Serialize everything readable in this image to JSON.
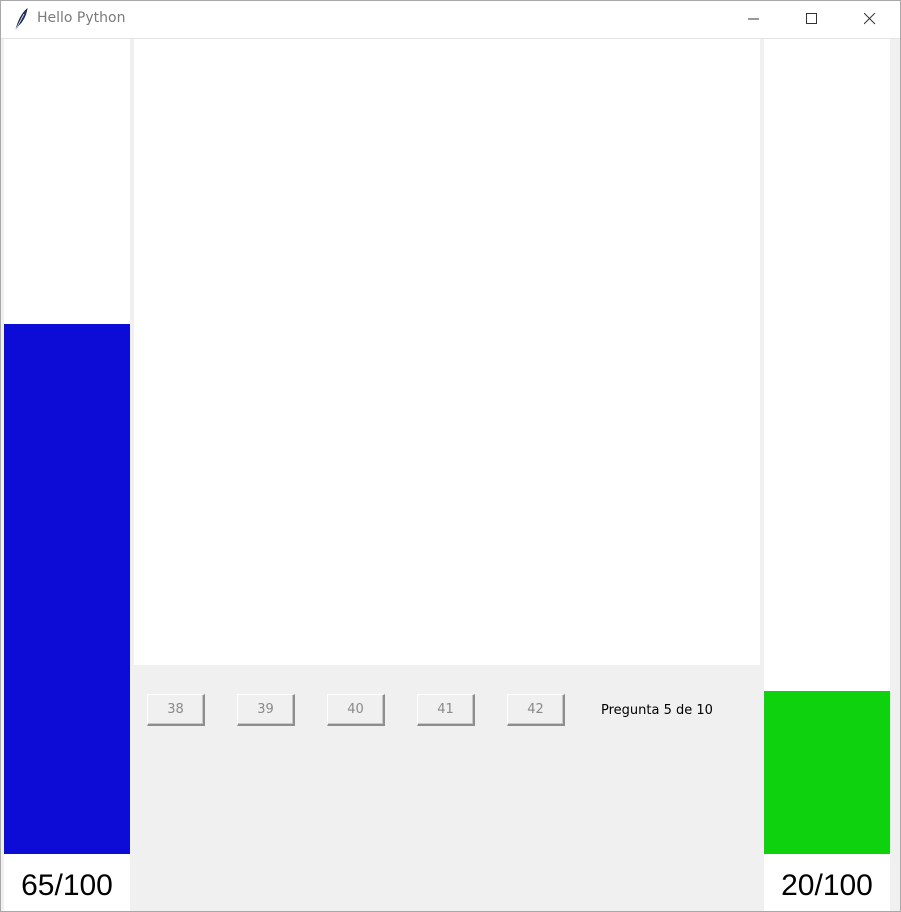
{
  "window": {
    "title": "Hello Python",
    "icon": "feather-icon",
    "controls": [
      "minimize-icon",
      "maximize-icon",
      "close-icon"
    ]
  },
  "left_meter": {
    "value": 65,
    "max": 100,
    "label": "65/100",
    "color": "#0c0cd6"
  },
  "right_meter": {
    "value": 20,
    "max": 100,
    "label": "20/100",
    "color": "#0ed20e"
  },
  "answers": [
    {
      "label": "38"
    },
    {
      "label": "39"
    },
    {
      "label": "40"
    },
    {
      "label": "41"
    },
    {
      "label": "42"
    }
  ],
  "status": {
    "question_text": "Pregunta 5 de 10"
  }
}
